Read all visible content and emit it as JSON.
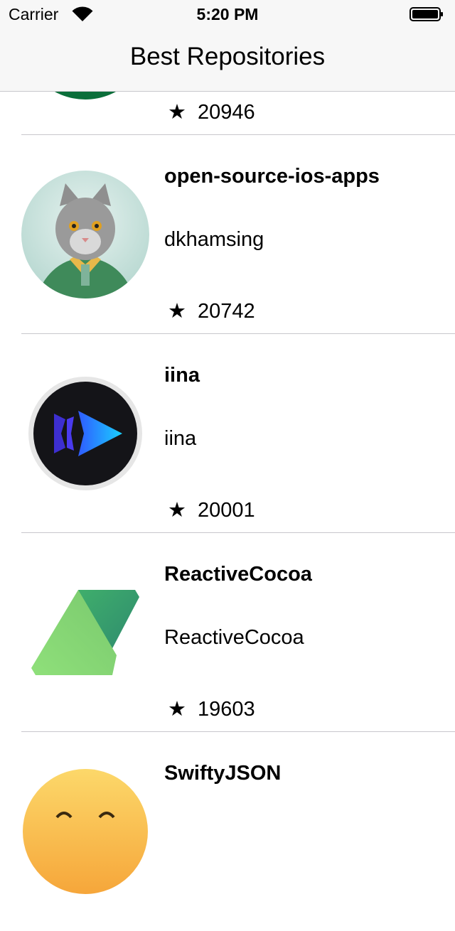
{
  "status_bar": {
    "carrier": "Carrier",
    "time": "5:20 PM"
  },
  "nav": {
    "title": "Best Repositories"
  },
  "star_glyph": "★",
  "repos": [
    {
      "name": "",
      "owner": "",
      "stars": "20946",
      "avatar_icon": "green-avatar-icon"
    },
    {
      "name": "open-source-ios-apps",
      "owner": "dkhamsing",
      "stars": "20742",
      "avatar_icon": "cat-avatar-icon"
    },
    {
      "name": "iina",
      "owner": "iina",
      "stars": "20001",
      "avatar_icon": "iina-logo-icon"
    },
    {
      "name": "ReactiveCocoa",
      "owner": "ReactiveCocoa",
      "stars": "19603",
      "avatar_icon": "reactivecocoa-logo-icon"
    },
    {
      "name": "SwiftyJSON",
      "owner": "",
      "stars": "",
      "avatar_icon": "swiftyjson-logo-icon"
    }
  ],
  "colors": {
    "bar_bg": "#f7f7f7",
    "separator": "#c8c7cc"
  }
}
